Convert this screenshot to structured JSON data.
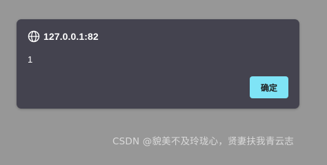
{
  "dialog": {
    "origin": "127.0.0.1:82",
    "message": "1",
    "ok_label": "确定"
  },
  "icons": {
    "origin": "globe-icon"
  },
  "colors": {
    "backdrop": "#979797",
    "dialog_bg": "#44434f",
    "button_bg": "#7fe4f6",
    "text": "#ffffff"
  },
  "watermark": "CSDN @貌美不及玲珑心，贤妻扶我青云志"
}
